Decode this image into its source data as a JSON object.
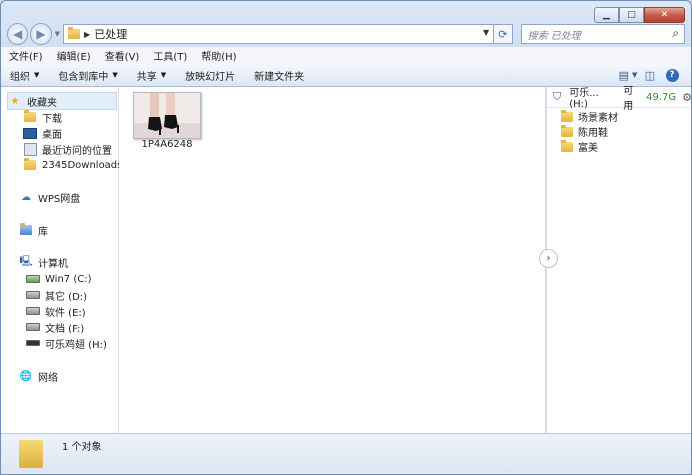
{
  "window": {
    "controls": {
      "minimize": "▁",
      "maximize": "□",
      "close": "✕"
    }
  },
  "address": {
    "path": "已处理"
  },
  "search": {
    "placeholder": "搜索 已处理"
  },
  "menu": [
    "文件(F)",
    "编辑(E)",
    "查看(V)",
    "工具(T)",
    "帮助(H)"
  ],
  "commands": [
    {
      "label": "组织",
      "dropdown": true
    },
    {
      "label": "包含到库中",
      "dropdown": true
    },
    {
      "label": "共享",
      "dropdown": true
    },
    {
      "label": "放映幻灯片",
      "dropdown": false
    },
    {
      "label": "新建文件夹",
      "dropdown": false
    }
  ],
  "nav": {
    "favorites": "收藏夹",
    "fav_items": [
      "下载",
      "桌面",
      "最近访问的位置",
      "2345Downloads"
    ],
    "wps": "WPS网盘",
    "library": "库",
    "computer": "计算机",
    "drives": [
      "Win7 (C:)",
      "其它 (D:)",
      "软件 (E:)",
      "文档 (F:)",
      "可乐鸡翅 (H:)"
    ],
    "network": "网络"
  },
  "files": [
    {
      "name": "1P4A6248",
      "type": "image"
    }
  ],
  "preview": {
    "drive_label": "可乐...(H:)",
    "free_label": "可用",
    "free_value": "49.7G",
    "folders": [
      "场景素材",
      "陈用鞋",
      "富美"
    ]
  },
  "status": {
    "text": "1 个对象"
  },
  "colors": {
    "accent": "#2e68b8",
    "free_space": "#2f8a2f"
  }
}
